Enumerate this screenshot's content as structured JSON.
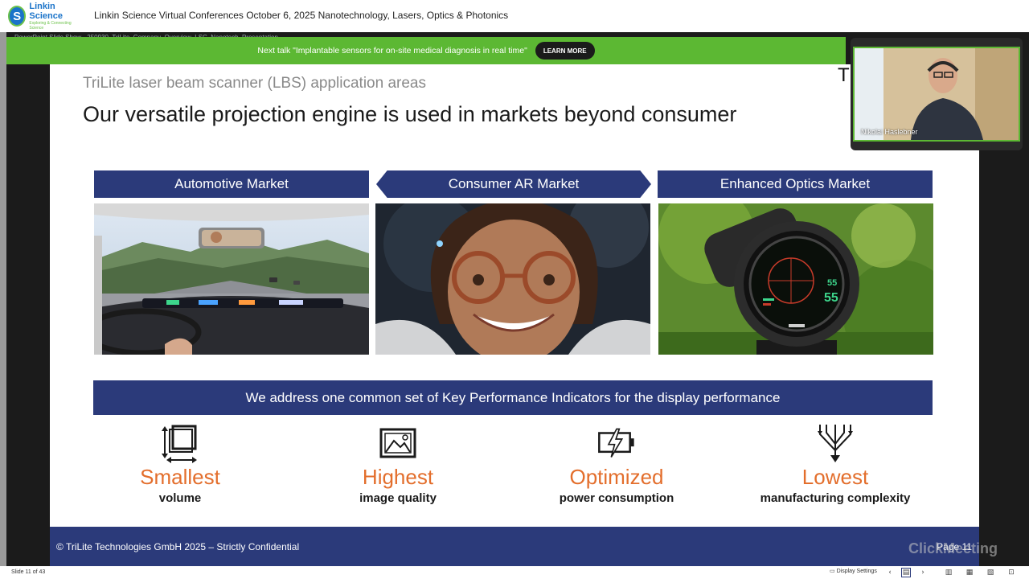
{
  "header": {
    "logo": {
      "mark": "S",
      "line1": "Linkin",
      "line2": "Science",
      "line3": "Exploring & Connecting Science"
    },
    "title": "Linkin Science Virtual Conferences October 6, 2025 Nanotechnology, Lasers, Optics & Photonics"
  },
  "player": {
    "doc_title": "PowerPoint Slide Show - 250930_TriLite_Company_Overview_LSC_Nanotech_Presentation"
  },
  "banner": {
    "text": "Next talk \"Implantable sensors for on-site medical diagnosis in real time\"",
    "button_label": "LEARN MORE",
    "color": "#5cb833"
  },
  "slide": {
    "subtitle": "TriLite laser beam scanner (LBS) application areas",
    "title": "Our versatile projection engine is used in markets beyond consumer",
    "corner_letter": "T",
    "markets": [
      {
        "label": "Automotive Market"
      },
      {
        "label": "Consumer AR  Market"
      },
      {
        "label": "Enhanced Optics Market"
      }
    ],
    "optics_display": {
      "value_small": "55",
      "value_large": "55"
    },
    "kpi_banner": "We address one common set of Key Performance Indicators for the display performance",
    "kpis": [
      {
        "main": "Smallest",
        "sub": "volume",
        "icon": "volume-cube-icon"
      },
      {
        "main": "Highest",
        "sub": "image quality",
        "icon": "image-icon"
      },
      {
        "main": "Optimized",
        "sub": "power consumption",
        "icon": "battery-bolt-icon"
      },
      {
        "main": "Lowest",
        "sub": "manufacturing complexity",
        "icon": "merge-arrows-icon"
      }
    ],
    "footer": {
      "copyright": "© TriLite Technologies GmbH 2025 – Strictly Confidential",
      "page": "Page 11"
    },
    "colors": {
      "navy": "#2b3a7a",
      "orange": "#e36e2c"
    }
  },
  "webcam": {
    "presenter_name": "Nikolai Haslebner"
  },
  "bottom_bar": {
    "slide_counter": "Slide 11 of 43",
    "display_settings": "Display Settings",
    "watermark": "ClickMeeting"
  }
}
